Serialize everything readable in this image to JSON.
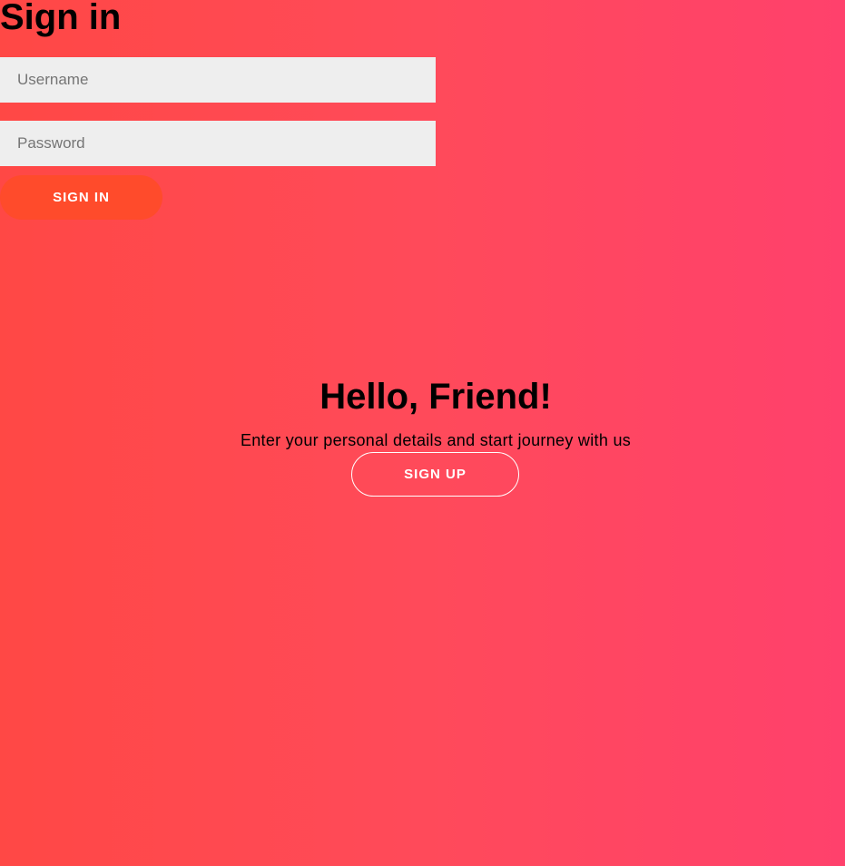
{
  "signin": {
    "title": "Sign in",
    "username_placeholder": "Username",
    "password_placeholder": "Password",
    "submit_label": "SIGN IN"
  },
  "overlay": {
    "title": "Hello, Friend!",
    "text": "Enter your personal details and start journey with us",
    "signup_label": "SIGN UP"
  },
  "colors": {
    "gradient_start": "#ff4845",
    "gradient_end": "#ff416c",
    "signin_button": "#ff4b2b",
    "input_background": "#eeeeee"
  }
}
